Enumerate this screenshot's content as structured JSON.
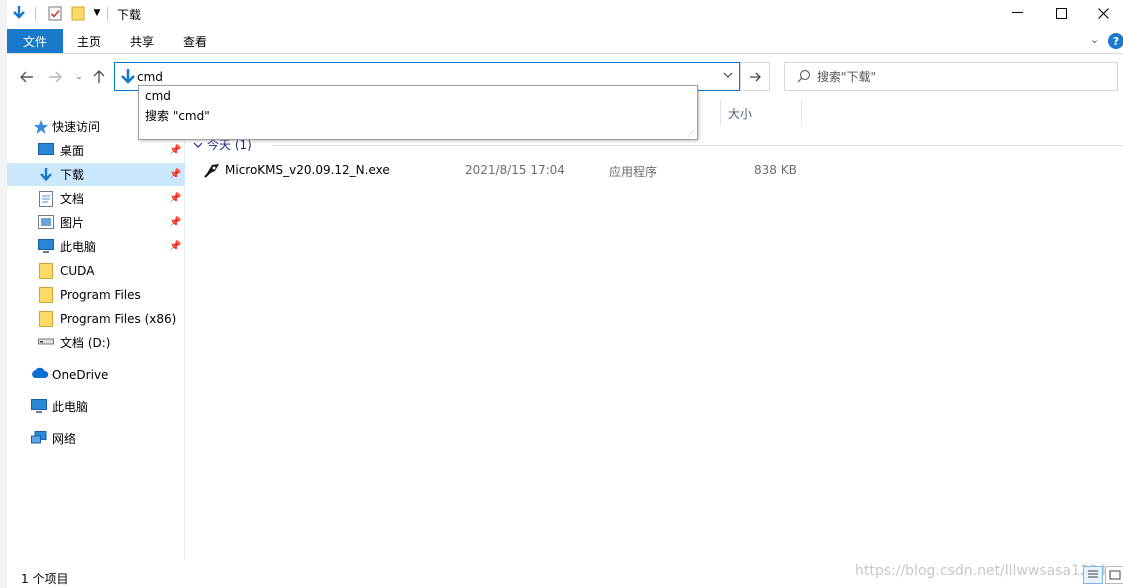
{
  "window": {
    "title": "下载"
  },
  "ribbon": {
    "tabs": [
      {
        "label": "文件",
        "active": true
      },
      {
        "label": "主页"
      },
      {
        "label": "共享"
      },
      {
        "label": "查看"
      }
    ],
    "help_label": "?"
  },
  "address": {
    "value": "cmd"
  },
  "search": {
    "placeholder": "搜索\"下载\""
  },
  "autocomplete": {
    "items": [
      "cmd",
      "搜索 \"cmd\""
    ]
  },
  "columns": {
    "size": "大小"
  },
  "sidebar": {
    "quick_access": "快速访问",
    "items": [
      {
        "label": "桌面",
        "pinned": true
      },
      {
        "label": "下载",
        "pinned": true,
        "selected": true
      },
      {
        "label": "文档",
        "pinned": true
      },
      {
        "label": "图片",
        "pinned": true
      },
      {
        "label": "此电脑",
        "pinned": true
      },
      {
        "label": "CUDA"
      },
      {
        "label": "Program Files"
      },
      {
        "label": "Program Files (x86)"
      },
      {
        "label": "文档 (D:)"
      }
    ],
    "onedrive": "OneDrive",
    "this_pc": "此电脑",
    "network": "网络"
  },
  "group": {
    "label": "今天 (1)"
  },
  "files": [
    {
      "name": "MicroKMS_v20.09.12_N.exe",
      "date": "2021/8/15 17:04",
      "type": "应用程序",
      "size": "838 KB"
    }
  ],
  "status": {
    "count": "1 个项目"
  },
  "watermark": "https://blog.csdn.net/lllwwsasa1234",
  "colors": {
    "accent": "#1979ca",
    "selection": "#cce8ff",
    "folder": "#ffd966"
  }
}
